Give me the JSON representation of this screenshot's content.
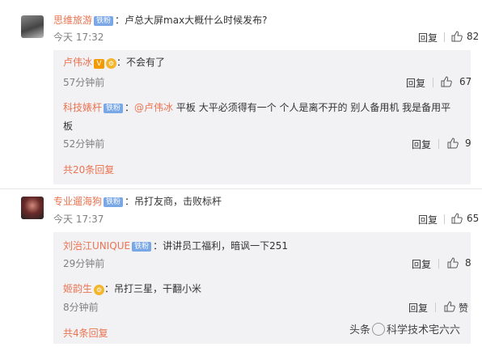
{
  "comments": [
    {
      "user": "思维旅游",
      "badge": "铁粉",
      "text": "：卢总大屏max大概什么时候发布?",
      "time": "今天 17:32",
      "reply": "回复",
      "likes": "82",
      "replies": [
        {
          "user": "卢伟冰",
          "vip": "V",
          "medal": "⚙",
          "text": "：不会有了",
          "time": "57分钟前",
          "reply": "回复",
          "likes": "67"
        },
        {
          "user": "科技婊杆",
          "badge": "铁粉",
          "text_prefix": "：",
          "mention": "@卢伟冰",
          "text": " 平板 大平必须得有一个  个人是离不开的 别人备用机 我是备用平",
          "text2": "板",
          "time": "52分钟前",
          "reply": "回复",
          "likes": "9"
        }
      ],
      "more": "共20条回复"
    },
    {
      "user": "专业遛海狗",
      "badge": "铁粉",
      "text": "：吊打友商，击败标杆",
      "time": "今天 17:37",
      "reply": "回复",
      "likes": "65",
      "replies": [
        {
          "user": "刘治江UNIQUE",
          "badge": "铁粉",
          "text": "：讲讲员工福利，暗讽一下251",
          "time": "29分钟前",
          "reply": "回复",
          "likes": "8"
        },
        {
          "user": "姬韵生",
          "medal": "⚙",
          "text": "：吊打三星，干翻小米",
          "time": "8分钟前",
          "reply": "回复",
          "likes": "赞"
        }
      ],
      "more": "共4条回复"
    }
  ],
  "watermark": {
    "prefix": "头条",
    "text": "科学技术宅六六"
  }
}
